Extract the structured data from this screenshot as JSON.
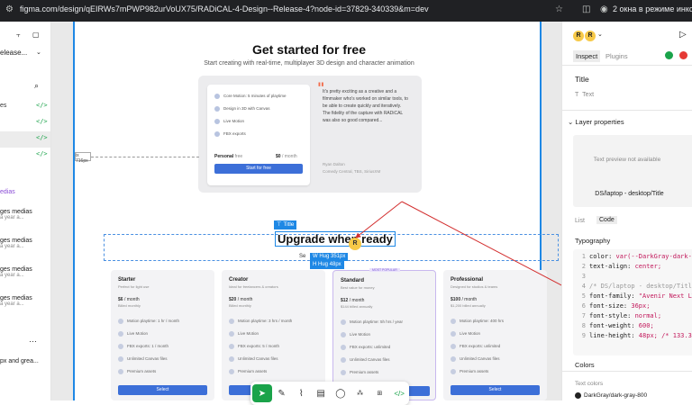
{
  "browser": {
    "url": "figma.com/design/qEIRWs7mPWP982urVoUX75/RADiCAL-4-Design--Release-4?node-id=37829-340339&m=dev",
    "incognito_label": "2 окна в режиме инкогн"
  },
  "left_panel": {
    "file_name": "elease...",
    "rows": [
      {
        "label": "es",
        "code": "</>"
      },
      {
        "label": "",
        "code": "</>"
      },
      {
        "label": "",
        "code": "</>"
      },
      {
        "label": "",
        "code": "</>"
      }
    ],
    "section_label": "edias",
    "history": [
      {
        "title": "ges medias",
        "meta": "a year a..."
      },
      {
        "title": "ges medias",
        "meta": "a year a..."
      },
      {
        "title": "ges medias",
        "meta": "a year a..."
      },
      {
        "title": "ges medias",
        "meta": "a year a..."
      }
    ],
    "bottom_item": "px and grea..."
  },
  "canvas": {
    "hero_title": "Get started for free",
    "hero_subtitle": "Start creating with real-time, multiplayer 3D design and character animation",
    "features": [
      "Core Motion: 5 minutes of playtime",
      "Design in 3D with Canvas",
      "Live Motion",
      "FBX exports"
    ],
    "personal_label": "Personal",
    "personal_tag": "free",
    "personal_price": "$0",
    "personal_per": "/ month",
    "start_button": "Start for free",
    "quote": "It's pretty exciting as a creative and a filmmaker who's worked on similar tools, to be able to create quickly and iteratively. The fidelity of the capture with RADiCAL was also so good compared...",
    "quote_author": "Ryan Dalton",
    "quote_company": "Comedy Central, TBS, SiriusXM",
    "handle_label": "ix 716px",
    "title_tag": "Title",
    "upgrade_text": "Upgrade when ready",
    "avatar_letter": "R",
    "hug_w": "W  Hug  351px",
    "hug_h": "H  Hug  48px",
    "see_text": "Se",
    "plans": [
      {
        "name": "Starter",
        "desc": "Perfect for light use",
        "price": "$6",
        "per": "/ month",
        "billing": "Billed monthly",
        "features": [
          "Motion playtime: 1 hr / month",
          "Live Motion",
          "FBX exports: 1 / month",
          "Unlimited Canvas files",
          "Premium assets"
        ]
      },
      {
        "name": "Creator",
        "desc": "Ideal for freelancers & creators",
        "price": "$20",
        "per": "/ month",
        "billing": "Billed monthly",
        "features": [
          "Motion playtime: 3 hrs / month",
          "Live Motion",
          "FBX exports: 5 / month",
          "Unlimited Canvas files",
          "Premium assets"
        ]
      },
      {
        "name": "Standard",
        "desc": "Best value for money",
        "price": "$12",
        "per": "/ month",
        "billing": "$144 billed annually",
        "features": [
          "Motion playtime: 5h hrs / year",
          "Live Motion",
          "FBX exports: unlimited",
          "Unlimited Canvas files",
          "Premium assets"
        ]
      },
      {
        "name": "Professional",
        "desc": "Designed for studios & teams",
        "price": "$100",
        "per": "/ month",
        "billing": "$1,200 billed annually",
        "features": [
          "Motion playtime: 400 hrs",
          "Live Motion",
          "FBX exports: unlimited",
          "Unlimited Canvas files",
          "Premium assets"
        ]
      }
    ],
    "badge": "MOST POPULAR",
    "select_label": "Select"
  },
  "right_panel": {
    "avatar_letter": "R",
    "tab_inspect": "Inspect",
    "tab_plugins": "Plugins",
    "layer_title": "Title",
    "layer_type": "Text",
    "layer_properties": "Layer properties",
    "preview_text": "Text preview not available",
    "path": "DS/laptop - desktop/Title",
    "tab_list": "List",
    "tab_code": "Code",
    "typography": "Typography",
    "code_lines": [
      {
        "n": "1",
        "prop": "color: ",
        "val": "var(--DarkGray-dark-gra"
      },
      {
        "n": "2",
        "prop": "text-align: ",
        "val": "center;"
      },
      {
        "n": "3",
        "prop": "",
        "val": ""
      },
      {
        "n": "4",
        "cmt": "/* DS/laptop - desktop/Title - "
      },
      {
        "n": "5",
        "prop": "font-family: ",
        "val": "\"Avenir Next LT Pr"
      },
      {
        "n": "6",
        "prop": "font-size: ",
        "val": "36px;"
      },
      {
        "n": "7",
        "prop": "font-style: ",
        "val": "normal;"
      },
      {
        "n": "8",
        "prop": "font-weight: ",
        "val": "600;"
      },
      {
        "n": "9",
        "prop": "line-height: ",
        "val": "48px; /* 133.333"
      }
    ],
    "colors": "Colors",
    "text_colors": "Text colors",
    "color_name": "DarkGray/dark-gray-800"
  },
  "colors": {
    "accent": "#1e88e5",
    "code_green": "#1aa34a",
    "select_blue": "#3c6fd8",
    "annotation_red": "#d32f2f"
  }
}
